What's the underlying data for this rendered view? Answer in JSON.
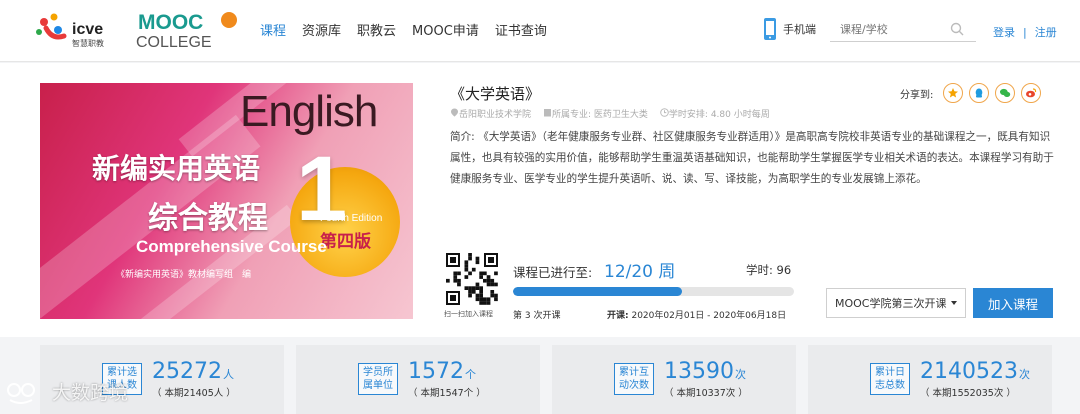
{
  "header": {
    "logo_icve": "icve",
    "logo_icve_sub": "智慧职教",
    "logo_mooc_top": "MOOC",
    "logo_mooc_bottom": "COLLEGE",
    "nav": [
      "课程",
      "资源库",
      "职教云",
      "MOOC申请",
      "证书查询"
    ],
    "phone_label": "手机端",
    "search_placeholder": "课程/学校",
    "login": "登录",
    "register": "注册",
    "separator": "|",
    "accent_color": "#2a86d4"
  },
  "course": {
    "cover": {
      "english": "English",
      "title_line1": "新编实用英语",
      "title_line2": "综合教程",
      "title_en": "Comprehensive Course",
      "author": "《新编实用英语》教材编写组　编",
      "number": "1",
      "fourth_edition": "Fourth Edition",
      "edition_cn": "第四版"
    },
    "title": "《大学英语》",
    "school": "岳阳职业技术学院",
    "major": "所属专业: 医药卫生大类",
    "schedule": "学时安排: 4.80 小时每周",
    "intro": "简介: 《大学英语》（老年健康服务专业群、社区健康服务专业群适用）》是高职高专院校非英语专业的基础课程之一，既具有知识属性，也具有较强的实用价值，能够帮助学生重温英语基础知识，也能帮助学生掌握医学专业相关术语的表达。本课程学习有助于健康服务专业、医学专业的学生提升英语听、说、读、写、译技能，为高职学生的专业发展锦上添花。",
    "share_label": "分享到:",
    "share_icons": [
      "star-icon",
      "qq-icon",
      "wechat-icon",
      "weibo-icon"
    ],
    "qr_label": "扫一扫加入课程",
    "progress_label": "课程已进行至:",
    "progress_value": "12/20 周",
    "progress_fraction": 0.6,
    "hours": "学时: 96",
    "session": "第 3 次开课",
    "dates_label": "开课:",
    "dates_value": "2020年02月01日 - 2020年06月18日",
    "select_value": "MOOC学院第三次开课",
    "join_label": "加入课程"
  },
  "stats": [
    {
      "tag": "累计选课人数",
      "value": "25272",
      "unit": "人",
      "sub": "（ 本期21405人 ）"
    },
    {
      "tag": "学员所属单位",
      "value": "1572",
      "unit": "个",
      "sub": "（ 本期1547个 ）"
    },
    {
      "tag": "累计互动次数",
      "value": "13590",
      "unit": "次",
      "sub": "（ 本期10337次 ）"
    },
    {
      "tag": "累计日志总数",
      "value": "2140523",
      "unit": "次",
      "sub": "（ 本期1552035次 ）"
    }
  ],
  "watermark": "大数跨境"
}
